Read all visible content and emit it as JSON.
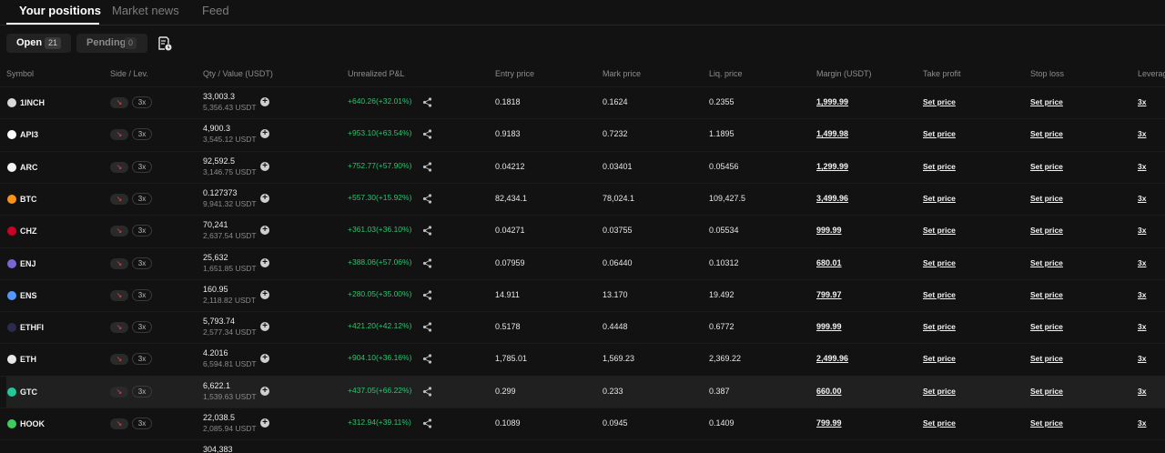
{
  "tabs": [
    {
      "label": "Your positions",
      "active": true
    },
    {
      "label": "Market news",
      "active": false
    },
    {
      "label": "Feed",
      "active": false
    }
  ],
  "filters": {
    "open": {
      "label": "Open",
      "count": "21"
    },
    "pending": {
      "label": "Pending",
      "count": "0"
    }
  },
  "columns": {
    "symbol": "Symbol",
    "side": "Side / Lev.",
    "qty": "Qty / Value (USDT)",
    "pnl": "Unrealized P&L",
    "entry": "Entry price",
    "mark": "Mark price",
    "liq": "Liq. price",
    "margin": "Margin (USDT)",
    "tp": "Take profit",
    "sl": "Stop loss",
    "lev": "Leverag"
  },
  "leverage_label": "3x",
  "take_profit_label": "Set price",
  "stop_loss_label": "Set price",
  "colors": {
    "profit": "#2ec270",
    "short": "#e0464f",
    "background": "#121212"
  },
  "rows": [
    {
      "symbol": "1INCH",
      "coin_color": "#d9d9d9",
      "qty": "33,003.3",
      "value": "5,356.43 USDT",
      "pnl": "+640.26(+32.01%)",
      "entry": "0.1818",
      "mark": "0.1624",
      "liq": "0.2355",
      "margin": "1,999.99"
    },
    {
      "symbol": "API3",
      "coin_color": "#ffffff",
      "qty": "4,900.3",
      "value": "3,545.12 USDT",
      "pnl": "+953.10(+63.54%)",
      "entry": "0.9183",
      "mark": "0.7232",
      "liq": "1.1895",
      "margin": "1,499.98"
    },
    {
      "symbol": "ARC",
      "coin_color": "#f5f5f5",
      "qty": "92,592.5",
      "value": "3,146.75 USDT",
      "pnl": "+752.77(+57.90%)",
      "entry": "0.04212",
      "mark": "0.03401",
      "liq": "0.05456",
      "margin": "1,299.99"
    },
    {
      "symbol": "BTC",
      "coin_color": "#f7931a",
      "qty": "0.127373",
      "value": "9,941.32 USDT",
      "pnl": "+557.30(+15.92%)",
      "entry": "82,434.1",
      "mark": "78,024.1",
      "liq": "109,427.5",
      "margin": "3,499.96"
    },
    {
      "symbol": "CHZ",
      "coin_color": "#cd0124",
      "qty": "70,241",
      "value": "2,637.54 USDT",
      "pnl": "+361.03(+36.10%)",
      "entry": "0.04271",
      "mark": "0.03755",
      "liq": "0.05534",
      "margin": "999.99"
    },
    {
      "symbol": "ENJ",
      "coin_color": "#7866d5",
      "qty": "25,632",
      "value": "1,651.85 USDT",
      "pnl": "+388.06(+57.06%)",
      "entry": "0.07959",
      "mark": "0.06440",
      "liq": "0.10312",
      "margin": "680.01"
    },
    {
      "symbol": "ENS",
      "coin_color": "#5298ff",
      "qty": "160.95",
      "value": "2,118.82 USDT",
      "pnl": "+280.05(+35.00%)",
      "entry": "14.911",
      "mark": "13.170",
      "liq": "19.492",
      "margin": "799.97"
    },
    {
      "symbol": "ETHFI",
      "coin_color": "#2b2b4d",
      "qty": "5,793.74",
      "value": "2,577.34 USDT",
      "pnl": "+421.20(+42.12%)",
      "entry": "0.5178",
      "mark": "0.4448",
      "liq": "0.6772",
      "margin": "999.99"
    },
    {
      "symbol": "ETH",
      "coin_color": "#e8e8e8",
      "qty": "4.2016",
      "value": "6,594.81 USDT",
      "pnl": "+904.10(+36.16%)",
      "entry": "1,785.01",
      "mark": "1,569.23",
      "liq": "2,369.22",
      "margin": "2,499.96"
    },
    {
      "symbol": "GTC",
      "coin_color": "#20c997",
      "qty": "6,622.1",
      "value": "1,539.63 USDT",
      "pnl": "+437.05(+66.22%)",
      "entry": "0.299",
      "mark": "0.233",
      "liq": "0.387",
      "margin": "660.00",
      "highlight": true
    },
    {
      "symbol": "HOOK",
      "coin_color": "#3ccf5b",
      "qty": "22,038.5",
      "value": "2,085.94 USDT",
      "pnl": "+312.94(+39.11%)",
      "entry": "0.1089",
      "mark": "0.0945",
      "liq": "0.1409",
      "margin": "799.99"
    },
    {
      "symbol": "",
      "coin_color": "#121212",
      "qty": "304,383",
      "value": "",
      "pnl": "",
      "entry": "",
      "mark": "",
      "liq": "",
      "margin": ""
    }
  ]
}
